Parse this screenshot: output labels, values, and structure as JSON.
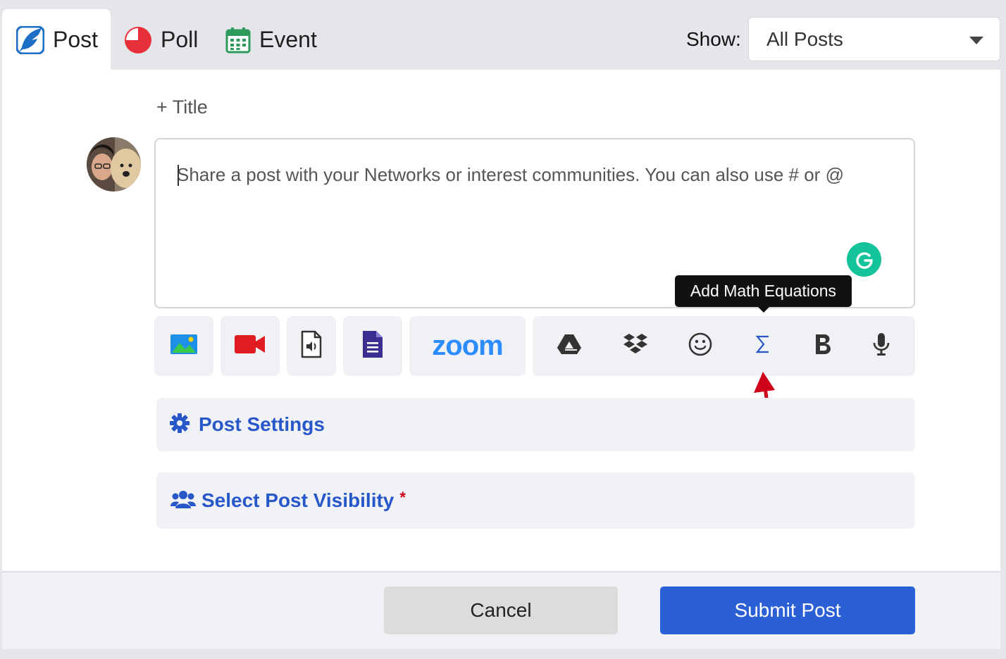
{
  "tabs": [
    {
      "label": "Post",
      "icon": "feather-icon",
      "active": true
    },
    {
      "label": "Poll",
      "icon": "pie-chart-icon",
      "active": false
    },
    {
      "label": "Event",
      "icon": "calendar-icon",
      "active": false
    }
  ],
  "filter": {
    "label": "Show:",
    "selected": "All Posts"
  },
  "composer": {
    "title_link": "+ Title",
    "placeholder": "Share a post with your Networks or interest communities. You can also use # or @",
    "value": ""
  },
  "tooltip": {
    "text": "Add Math Equations"
  },
  "toolbar": {
    "zoom_label": "zoom",
    "group_icons": [
      "google-drive-icon",
      "dropbox-icon",
      "emoji-icon",
      "sigma-icon",
      "bold-icon",
      "microphone-icon"
    ]
  },
  "sections": {
    "settings": "Post Settings",
    "visibility": "Select Post Visibility",
    "required_mark": "*"
  },
  "footer": {
    "cancel": "Cancel",
    "submit": "Submit Post"
  },
  "colors": {
    "accent": "#2a5fd6",
    "link": "#2757c9",
    "required": "#d0021b",
    "arrow": "#d0021b"
  }
}
